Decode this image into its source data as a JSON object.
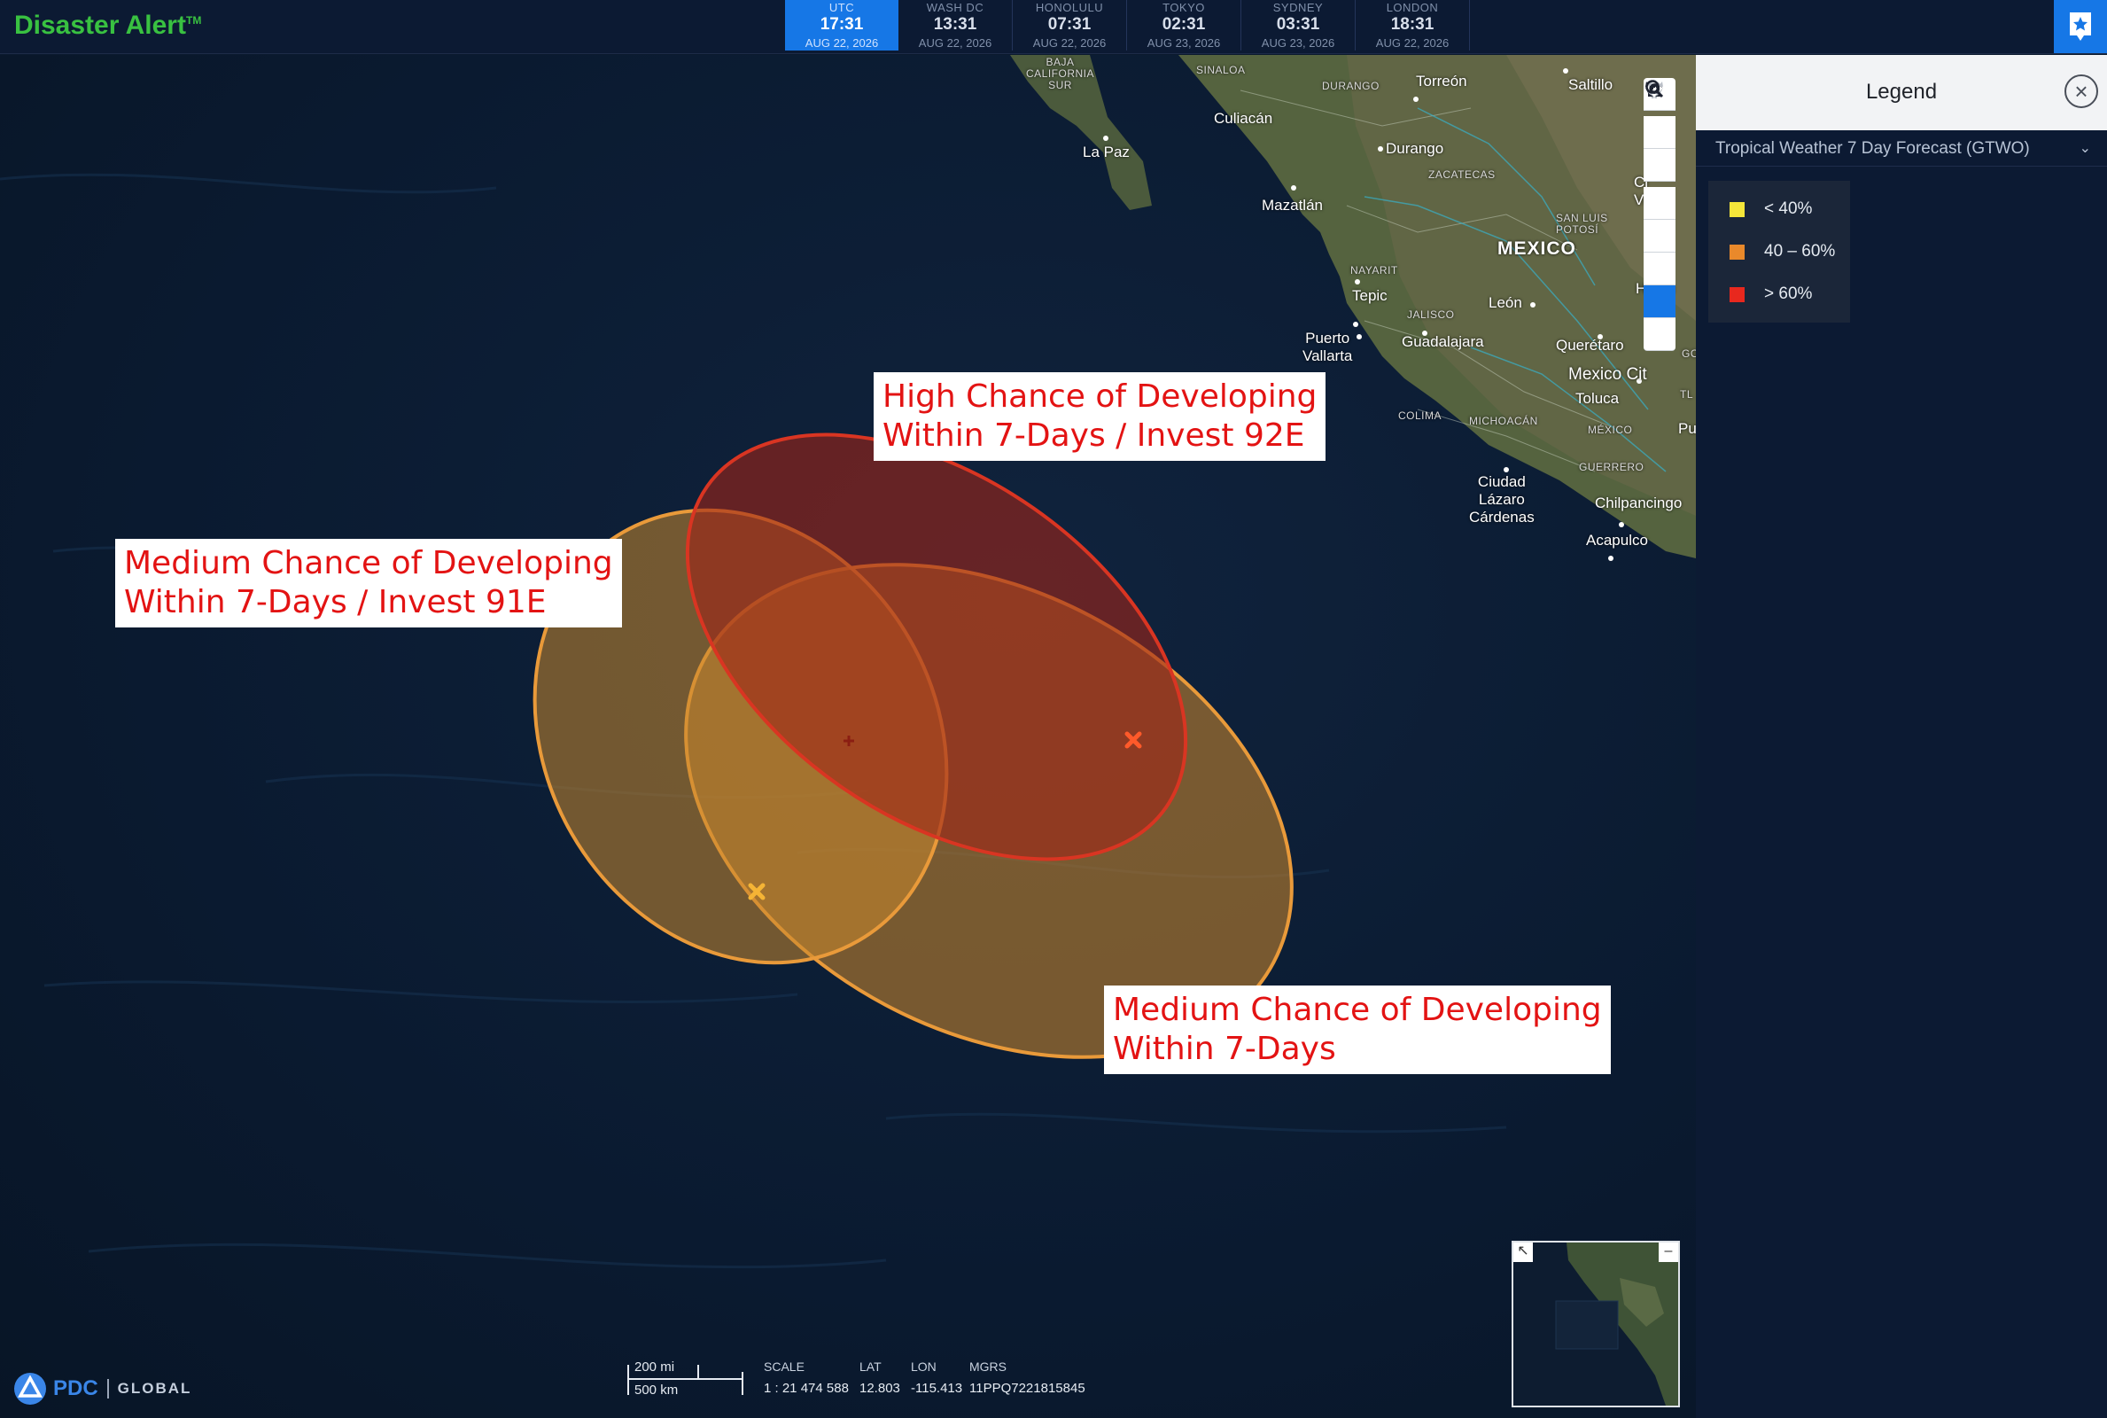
{
  "app": {
    "title": "Disaster Alert",
    "trademark": "TM"
  },
  "clocks": [
    {
      "zone": "UTC",
      "time": "17:31",
      "date": "AUG 22, 2026"
    },
    {
      "zone": "WASH DC",
      "time": "13:31",
      "date": "AUG 22, 2026"
    },
    {
      "zone": "HONOLULU",
      "time": "07:31",
      "date": "AUG 22, 2026"
    },
    {
      "zone": "TOKYO",
      "time": "02:31",
      "date": "AUG 23, 2026"
    },
    {
      "zone": "SYDNEY",
      "time": "03:31",
      "date": "AUG 23, 2026"
    },
    {
      "zone": "LONDON",
      "time": "18:31",
      "date": "AUG 22, 2026"
    }
  ],
  "map": {
    "annotations": {
      "high": [
        "High Chance of Developing",
        "Within 7-Days / Invest 92E"
      ],
      "medium_91e": [
        "Medium Chance of Developing",
        "Within 7-Days / Invest 91E"
      ],
      "medium": [
        "Medium Chance of Developing",
        "Within 7-Days"
      ]
    },
    "places": {
      "baja": [
        "BAJA",
        "CALIFORNIA",
        "SUR"
      ],
      "sinaloa": "SINALOA",
      "durango_state": "DURANGO",
      "torreon": "Torreón",
      "saltillo": "Saltillo",
      "culiacan": "Culiacán",
      "la_paz": "La Paz",
      "durango": "Durango",
      "zacatecas": "ZACATECAS",
      "mazatlan": "Mazatlán",
      "san_luis": [
        "SAN LUIS",
        "POTOSÍ"
      ],
      "mexico": "MEXICO",
      "nayarit": "NAYARIT",
      "tepic": "Tepic",
      "jalisco": "JALISCO",
      "leon": "León",
      "puerto_vallarta": [
        "Puerto",
        "Vallarta"
      ],
      "guadalajara": "Guadalajara",
      "queretaro": "Querétaro",
      "mexico_city": "Mexico Cit",
      "toluca": "Toluca",
      "colima": "COLIMA",
      "michoacan": "MICHOACÁN",
      "mexico_state": "MÉXICO",
      "guerrero": "GUERRERO",
      "lazaro": [
        "Ciudad",
        "Lázaro",
        "Cárdenas"
      ],
      "chilpancingo": "Chilpancingo",
      "acapulco": "Acapulco",
      "ci_victoria": [
        "Ci",
        "Victo"
      ],
      "huejutla": "Hueju",
      "pu": "Pu",
      "tl": "TL",
      "go": "GO"
    }
  },
  "legend": {
    "title": "Legend",
    "layer": "Tropical Weather 7 Day Forecast (GTWO)",
    "items": [
      {
        "label": "< 40%",
        "color": "#f5e63a"
      },
      {
        "label": "40 – 60%",
        "color": "#e9892b"
      },
      {
        "label": "> 60%",
        "color": "#e8281e"
      }
    ]
  },
  "scale": {
    "mi": "200 mi",
    "km": "500 km",
    "scale_label": "SCALE",
    "scale_value": "1 : 21 474 588",
    "lat_label": "LAT",
    "lat_value": "12.803",
    "lon_label": "LON",
    "lon_value": "-115.413",
    "mgrs_label": "MGRS",
    "mgrs_value": "11PPQ7221815845"
  },
  "footer": {
    "brand": "PDC",
    "tagline": "GLOBAL"
  }
}
